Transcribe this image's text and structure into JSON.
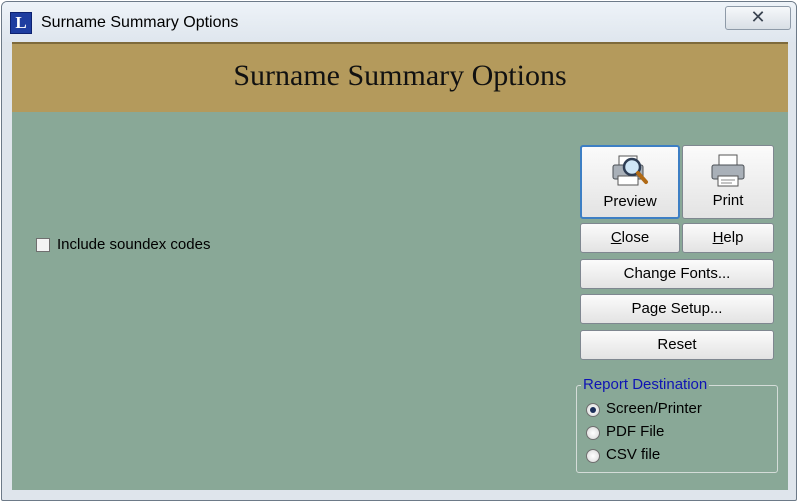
{
  "window": {
    "title": "Surname Summary Options",
    "app_icon_letter": "L",
    "close_glyph": "✕"
  },
  "header": {
    "title": "Surname Summary Options"
  },
  "options": {
    "include_soundex_label": "Include soundex codes",
    "include_soundex_checked": false
  },
  "buttons": {
    "preview": {
      "label": "Preview",
      "icon": "print-preview-icon"
    },
    "print": {
      "label": "Print",
      "icon": "printer-icon"
    },
    "close_hotkey": "C",
    "close_rest": "lose",
    "help_hotkey": "H",
    "help_rest": "elp",
    "change_fonts": "Change Fonts...",
    "page_setup": "Page Setup...",
    "reset": "Reset"
  },
  "report_destination": {
    "legend": "Report Destination",
    "options": [
      {
        "label": "Screen/Printer",
        "selected": true
      },
      {
        "label": "PDF File",
        "selected": false
      },
      {
        "label": "CSV file",
        "selected": false
      }
    ]
  },
  "colors": {
    "header_band": "#b49a5c",
    "content_background": "#89a897",
    "legend_text": "#0f14b4",
    "default_button_border": "#3d7fc4"
  }
}
